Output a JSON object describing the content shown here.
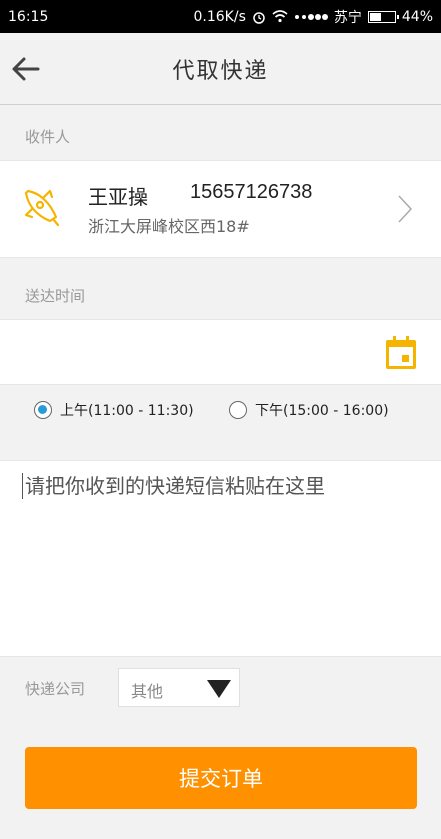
{
  "status_bar": {
    "time": "16:15",
    "speed": "0.16K/s",
    "carrier": "苏宁",
    "battery": "44%",
    "battery_level": 0.44
  },
  "header": {
    "title": "代取快递"
  },
  "recipient": {
    "section_label": "收件人",
    "name": "王亚操",
    "phone": "15657126738",
    "address": "浙江大屏峰校区西18#"
  },
  "delivery_time": {
    "section_label": "送达时间",
    "options": [
      {
        "label": "上午(11:00 - 11:30)",
        "selected": true
      },
      {
        "label": "下午(15:00 - 16:00)",
        "selected": false
      }
    ]
  },
  "sms_input": {
    "placeholder": "请把你收到的快递短信粘贴在这里"
  },
  "company": {
    "label": "快递公司",
    "selected": "其他"
  },
  "submit": {
    "label": "提交订单"
  },
  "colors": {
    "accent": "#ff9000",
    "icon_yellow": "#f5b400",
    "radio_selected": "#2a9bd8"
  }
}
